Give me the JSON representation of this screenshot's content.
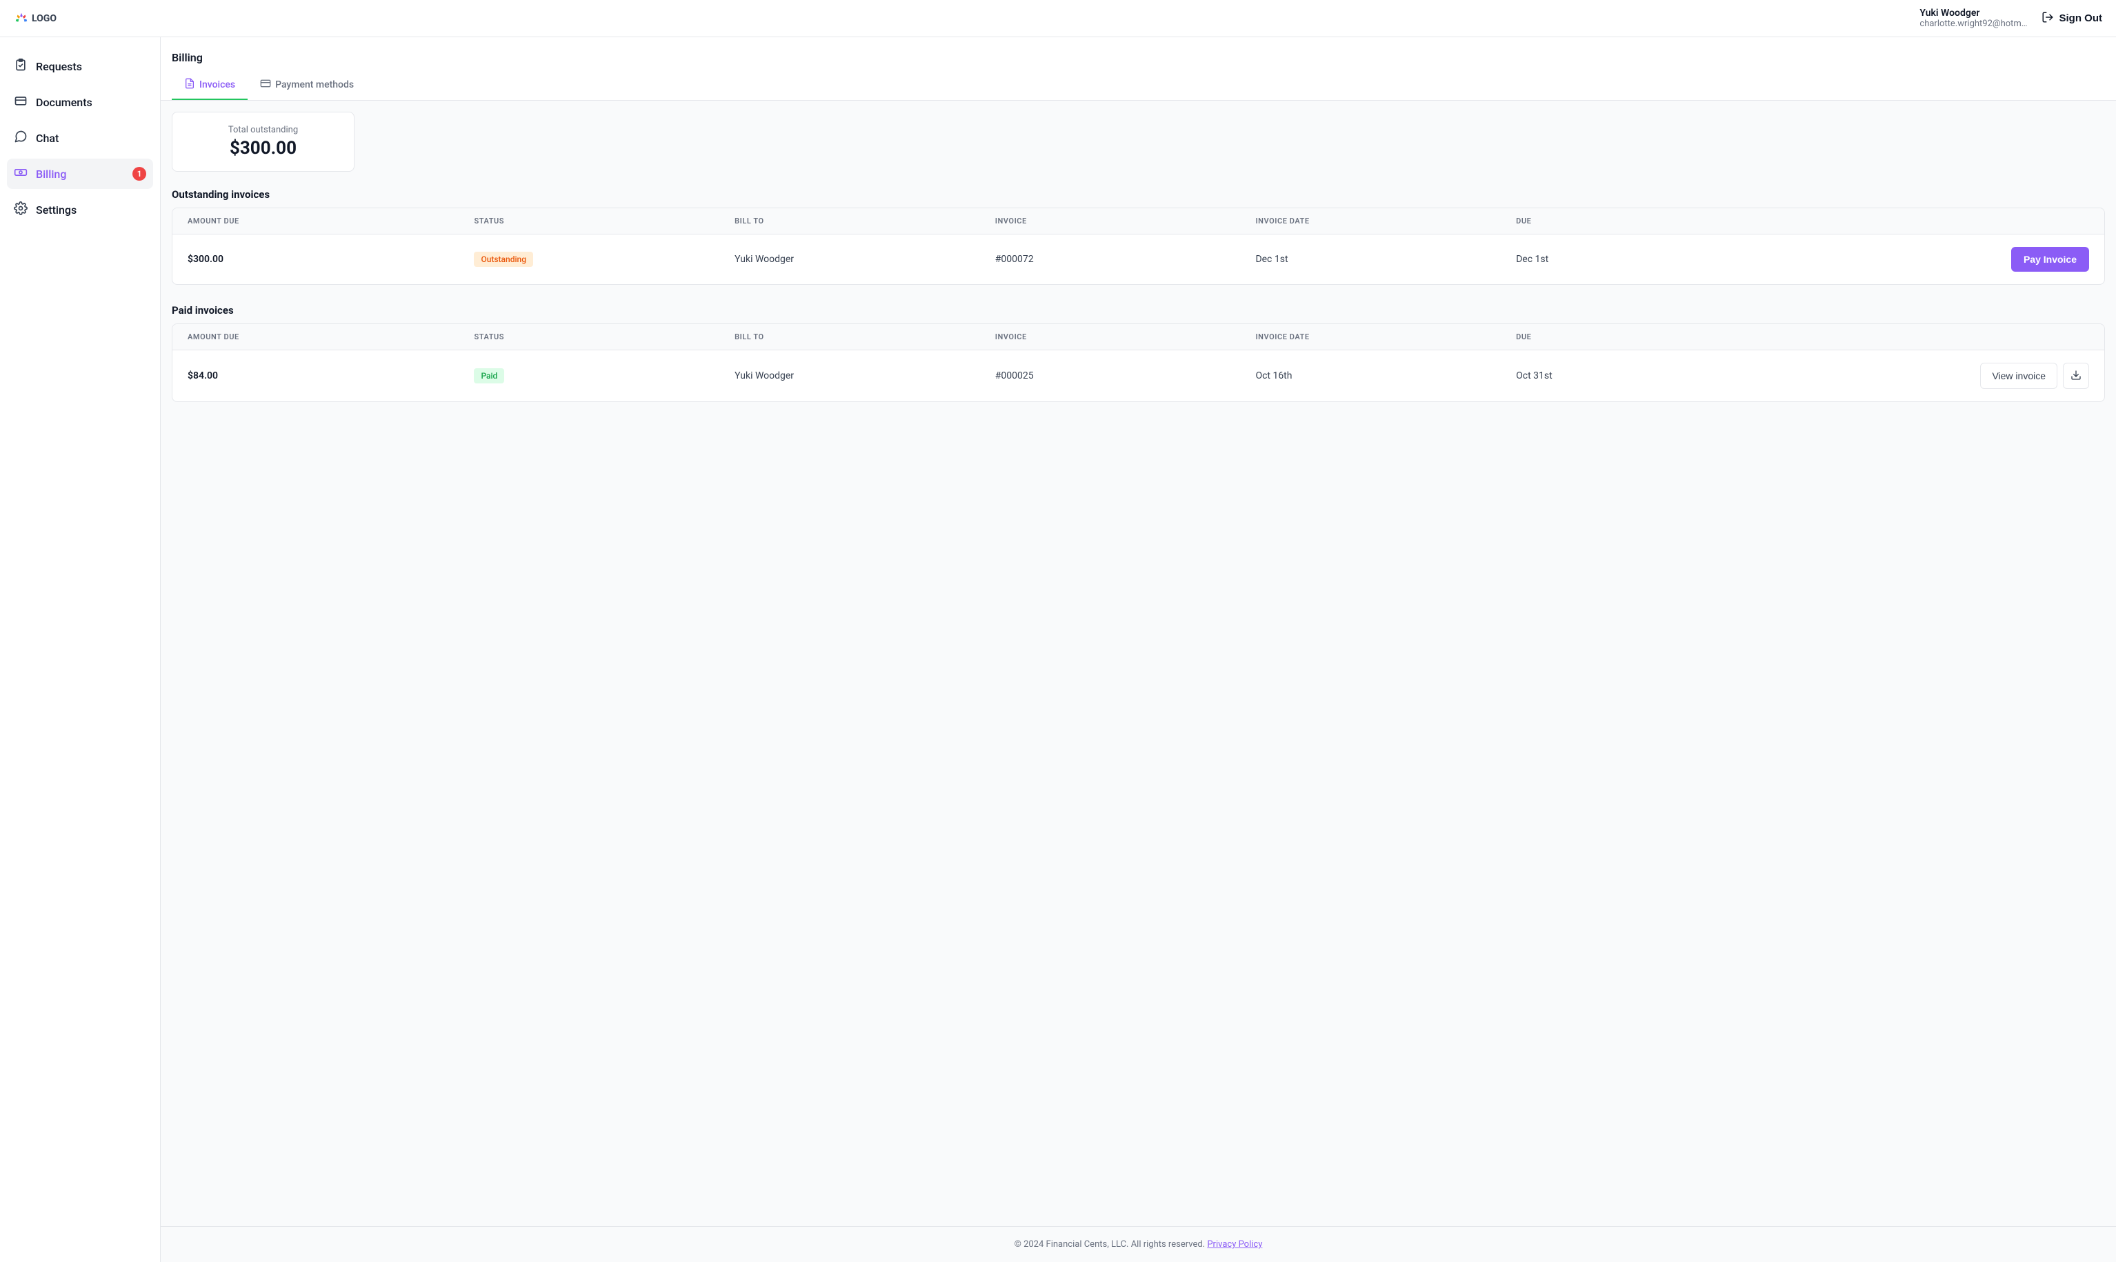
{
  "header": {
    "logo_text": "LOGO",
    "user_name": "Yuki Woodger",
    "user_email": "charlotte.wright92@hotm…",
    "signout_label": "Sign Out"
  },
  "sidebar": {
    "items": [
      {
        "label": "Requests",
        "active": false
      },
      {
        "label": "Documents",
        "active": false
      },
      {
        "label": "Chat",
        "active": false
      },
      {
        "label": "Billing",
        "active": true,
        "badge": "1"
      },
      {
        "label": "Settings",
        "active": false
      }
    ]
  },
  "page": {
    "title": "Billing",
    "tabs": [
      {
        "label": "Invoices",
        "active": true
      },
      {
        "label": "Payment methods",
        "active": false
      }
    ]
  },
  "summary": {
    "label": "Total outstanding",
    "value": "$300.00"
  },
  "outstanding": {
    "title": "Outstanding invoices",
    "columns": [
      "AMOUNT DUE",
      "STATUS",
      "BILL TO",
      "INVOICE",
      "INVOICE DATE",
      "DUE"
    ],
    "rows": [
      {
        "amount": "$300.00",
        "status": "Outstanding",
        "bill_to": "Yuki Woodger",
        "invoice": "#000072",
        "invoice_date": "Dec 1st",
        "due": "Dec 1st",
        "action_label": "Pay Invoice"
      }
    ]
  },
  "paid": {
    "title": "Paid invoices",
    "columns": [
      "AMOUNT DUE",
      "STATUS",
      "BILL TO",
      "INVOICE",
      "INVOICE DATE",
      "DUE"
    ],
    "rows": [
      {
        "amount": "$84.00",
        "status": "Paid",
        "bill_to": "Yuki Woodger",
        "invoice": "#000025",
        "invoice_date": "Oct 16th",
        "due": "Oct 31st",
        "action_label": "View invoice"
      }
    ]
  },
  "footer": {
    "copyright": "© 2024 Financial Cents, LLC. All rights reserved.",
    "privacy_label": "Privacy Policy"
  }
}
